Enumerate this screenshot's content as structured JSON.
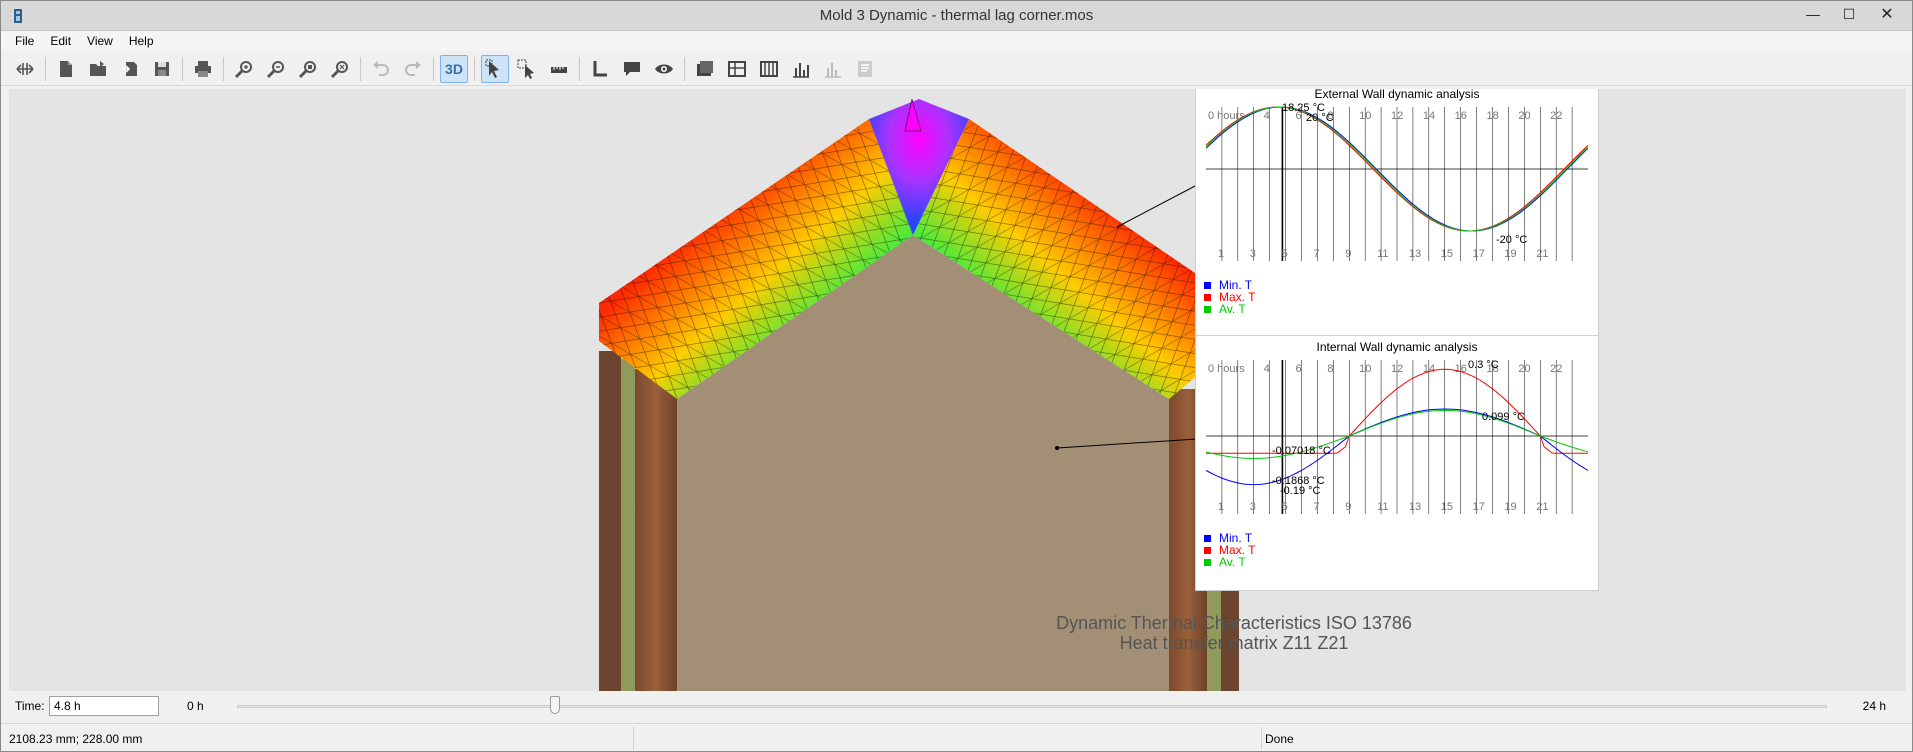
{
  "window": {
    "title": "Mold 3 Dynamic - thermal lag corner.mos",
    "min": "—",
    "max": "☐",
    "close": "✕"
  },
  "menu": [
    "File",
    "Edit",
    "View",
    "Help"
  ],
  "toolbar": {
    "three_d_label": "3D"
  },
  "panels": {
    "external": {
      "title": "External Wall dynamic analysis",
      "hours_top": [
        "0 hours",
        "4",
        "6",
        "8",
        "10",
        "12",
        "14",
        "16",
        "18",
        "20",
        "22"
      ],
      "hours_bottom": [
        "1",
        "3",
        "5",
        "7",
        "9",
        "11",
        "13",
        "15",
        "17",
        "19",
        "21"
      ],
      "labels": {
        "max_temp": "18.25 °C",
        "peak": "20 °C",
        "min": "-20 °C"
      },
      "legend": [
        {
          "name": "Min. T",
          "color": "#0000ff"
        },
        {
          "name": "Max. T",
          "color": "#ff0000"
        },
        {
          "name": "Av. T",
          "color": "#00cc00"
        }
      ]
    },
    "internal": {
      "title": "Internal Wall dynamic analysis",
      "hours_top": [
        "0 hours",
        "4",
        "6",
        "8",
        "10",
        "12",
        "14",
        "16",
        "18",
        "20",
        "22"
      ],
      "hours_bottom": [
        "1",
        "3",
        "5",
        "7",
        "9",
        "11",
        "13",
        "15",
        "17",
        "19",
        "21"
      ],
      "labels": {
        "peak": "0.3 °C",
        "avg_peak": "0.099 °C",
        "current": "-0.07018 °C",
        "min_current": "-0.1868 °C",
        "min": "-0.19 °C"
      },
      "legend": [
        {
          "name": "Min. T",
          "color": "#0000ff"
        },
        {
          "name": "Max. T",
          "color": "#ff0000"
        },
        {
          "name": "Av. T",
          "color": "#00cc00"
        }
      ]
    }
  },
  "caption": {
    "line1": "Dynamic Thermal Characteristics ISO 13786",
    "line2": "Heat transfer matrix Z11 Z21"
  },
  "time": {
    "label": "Time:",
    "value": "4.8 h",
    "start": "0 h",
    "end": "24 h",
    "position_fraction": 0.2
  },
  "status": {
    "coords": "2108.23 mm; 228.00 mm",
    "state": "Done"
  },
  "colors": {
    "titlebar": "#d8d8d8",
    "canvas": "#e4e4e4",
    "wood": "#a38e76",
    "accent": "#3a6ea5"
  }
}
